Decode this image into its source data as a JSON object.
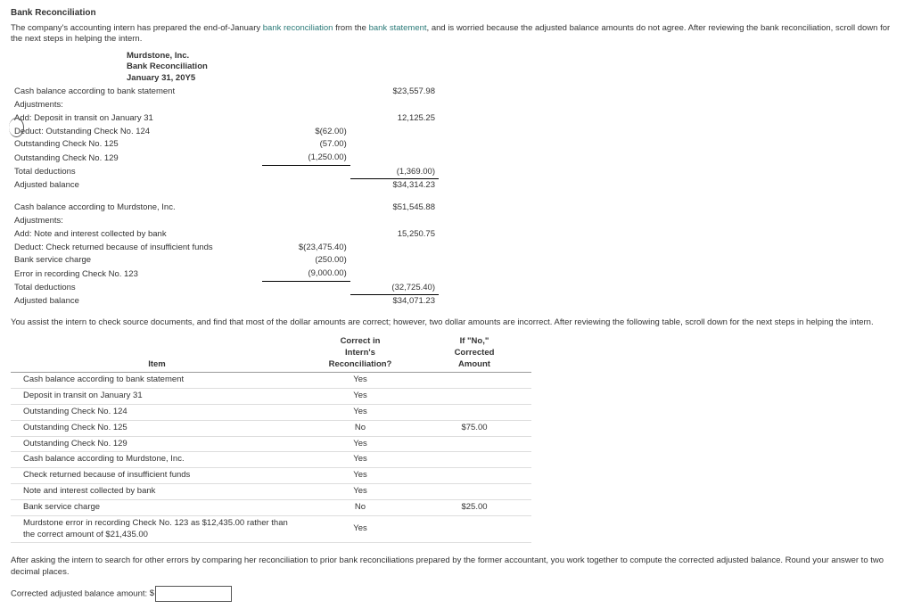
{
  "title": "Bank Reconciliation",
  "intro_pre": "The company's accounting intern has prepared the end-of-January ",
  "intro_kw1": "bank reconciliation",
  "intro_mid": " from the ",
  "intro_kw2": "bank statement",
  "intro_post": ", and is worried because the adjusted balance amounts do not agree. After reviewing the bank reconciliation, scroll down for the next steps in helping the intern.",
  "company": "Murdstone, Inc.",
  "doc": "Bank Reconciliation",
  "date": "January 31, 20Y5",
  "r": {
    "l1": "Cash balance according to bank statement",
    "v1": "$23,557.98",
    "l2": "Adjustments:",
    "l3": "Add: Deposit in transit on January 31",
    "v3": "12,125.25",
    "l4": "Deduct: Outstanding Check No. 124",
    "c4": "$(62.00)",
    "l5": "Outstanding Check No. 125",
    "c5": "(57.00)",
    "l6": "Outstanding Check No. 129",
    "c6": "(1,250.00)",
    "l7": "Total deductions",
    "v7": "(1,369.00)",
    "l8": "Adjusted balance",
    "v8": "$34,314.23",
    "l9": "Cash balance according to Murdstone, Inc.",
    "v9": "$51,545.88",
    "l10": "Adjustments:",
    "l11": "Add: Note and interest collected by bank",
    "v11": "15,250.75",
    "l12": "Deduct: Check returned because of insufficient funds",
    "c12": "$(23,475.40)",
    "l13": "Bank service charge",
    "c13": "(250.00)",
    "l14": "Error in recording Check No. 123",
    "c14": "(9,000.00)",
    "l15": "Total deductions",
    "v15": "(32,725.40)",
    "l16": "Adjusted balance",
    "v16": "$34,071.23"
  },
  "mid_note": "You assist the intern to check source documents, and find that most of the dollar amounts are correct; however, two dollar amounts are incorrect. After reviewing the following table, scroll down for the next steps in helping the intern.",
  "th1": "Item",
  "th2a": "Correct in",
  "th2b": "Intern's",
  "th2c": "Reconciliation?",
  "th3a": "If \"No,\"",
  "th3b": "Corrected",
  "th3c": "Amount",
  "rows": [
    {
      "item": "Cash balance according to bank statement",
      "ok": "Yes",
      "amt": ""
    },
    {
      "item": "Deposit in transit on January 31",
      "ok": "Yes",
      "amt": ""
    },
    {
      "item": "Outstanding Check No. 124",
      "ok": "Yes",
      "amt": ""
    },
    {
      "item": "Outstanding Check No. 125",
      "ok": "No",
      "amt": "$75.00"
    },
    {
      "item": "Outstanding Check No. 129",
      "ok": "Yes",
      "amt": ""
    },
    {
      "item": "Cash balance according to Murdstone, Inc.",
      "ok": "Yes",
      "amt": ""
    },
    {
      "item": "Check returned because of insufficient funds",
      "ok": "Yes",
      "amt": ""
    },
    {
      "item": "Note and interest collected by bank",
      "ok": "Yes",
      "amt": ""
    },
    {
      "item": "Bank service charge",
      "ok": "No",
      "amt": "$25.00"
    },
    {
      "item": "Murdstone error in recording Check No. 123 as $12,435.00 rather than the correct amount of $21,435.00",
      "ok": "Yes",
      "amt": ""
    }
  ],
  "final_note": "After asking the intern to search for other errors by comparing her reconciliation to prior bank reconciliations prepared by the former accountant, you work together to compute the corrected adjusted balance. Round your answer to two decimal places.",
  "ans_label": "Corrected adjusted balance amount: ",
  "ans_prefix": "$"
}
